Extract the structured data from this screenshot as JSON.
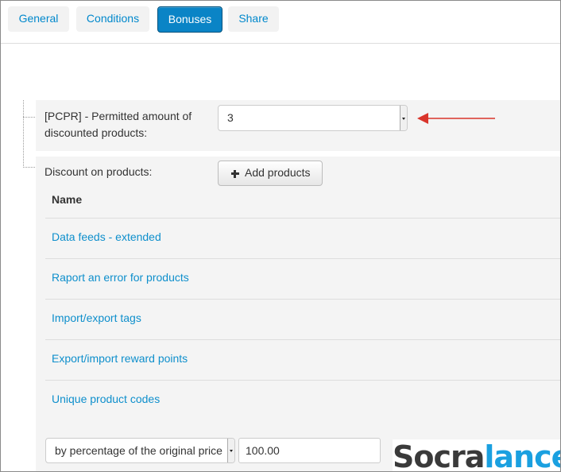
{
  "tabs": [
    {
      "label": "General",
      "active": false
    },
    {
      "label": "Conditions",
      "active": false
    },
    {
      "label": "Bonuses",
      "active": true
    },
    {
      "label": "Share",
      "active": false
    }
  ],
  "pcpr": {
    "label_line1": "[PCPR] - Permitted amount of",
    "label_line2": "discounted products:",
    "selected_value": "3"
  },
  "discount": {
    "label": "Discount on products:",
    "add_button_label": "Add products",
    "column_header": "Name",
    "products": [
      "Data feeds - extended",
      "Raport an error for products",
      "Import/export tags",
      "Export/import reward points",
      "Unique product codes"
    ],
    "method_selected": "by percentage of the original price",
    "amount_value": "100.00"
  },
  "annotation": {
    "arrow_color": "#d9342b"
  },
  "watermark": {
    "part1": "Socra",
    "part2": "lance"
  },
  "colors": {
    "accent": "#0a84c6",
    "link": "#0e8fcc"
  }
}
